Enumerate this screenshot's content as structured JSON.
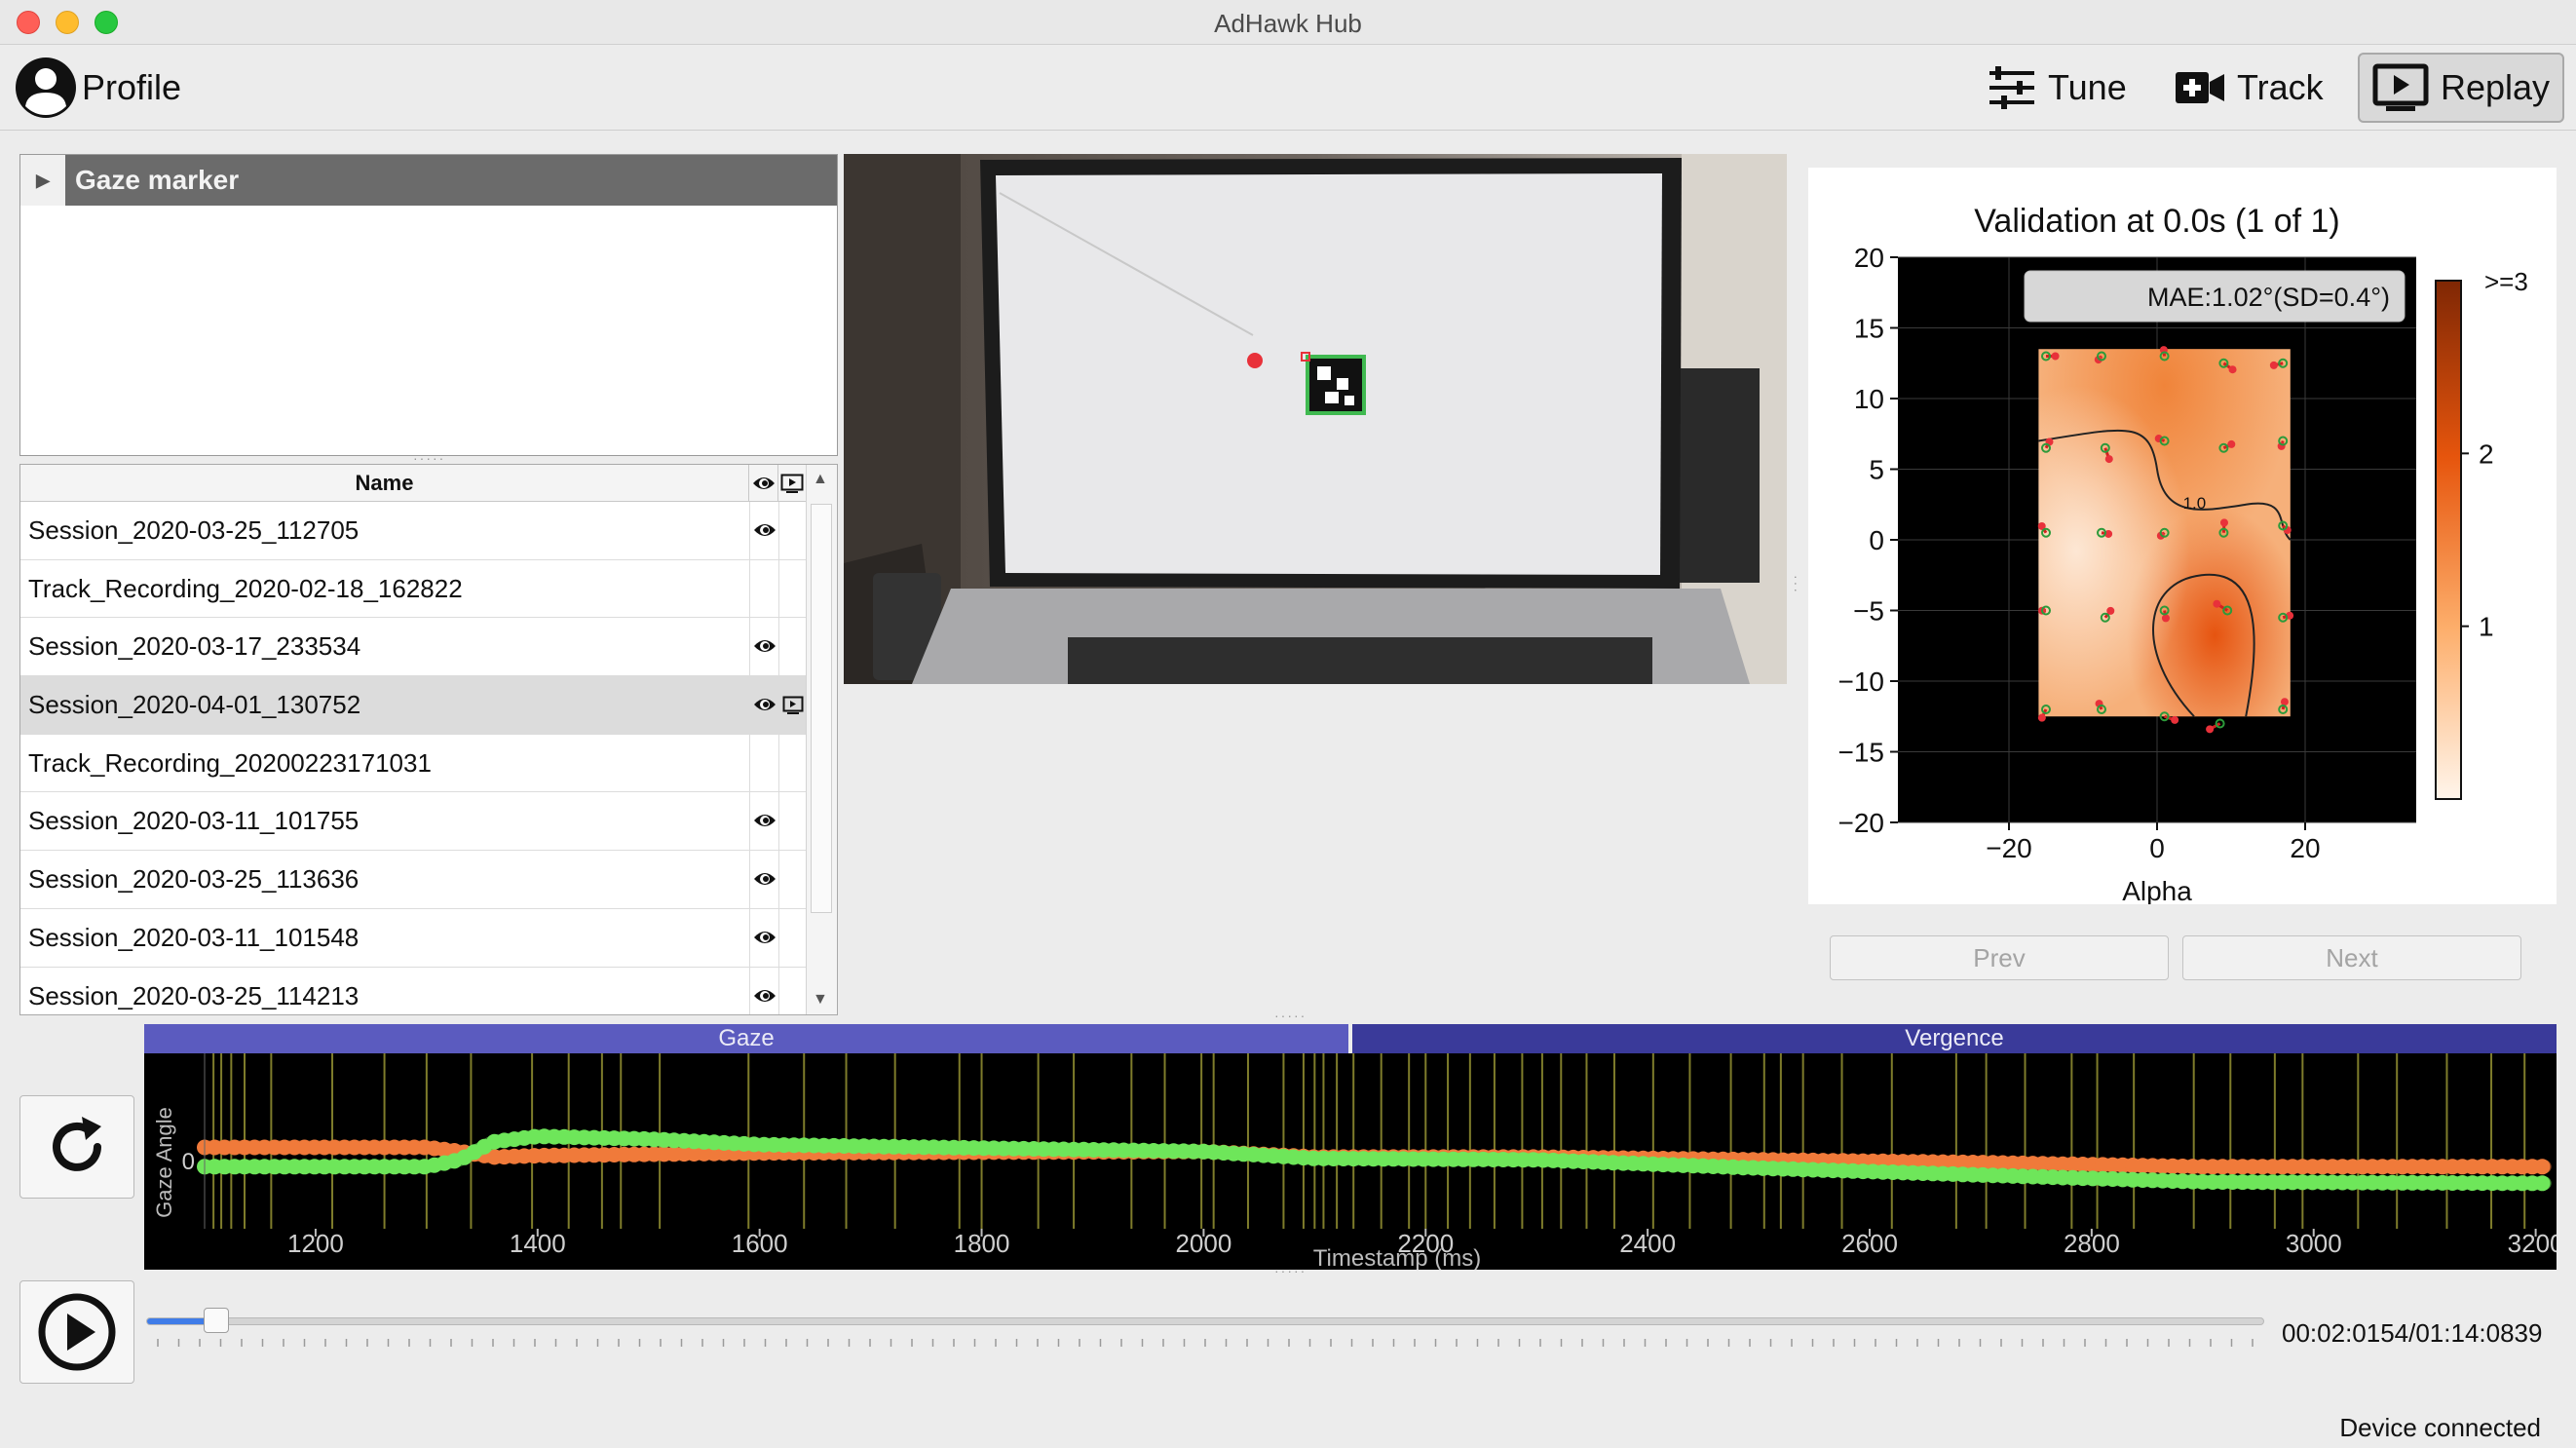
{
  "window": {
    "title": "AdHawk Hub"
  },
  "toolbar": {
    "profile_label": "Profile",
    "tune_label": "Tune",
    "track_label": "Track",
    "replay_label": "Replay",
    "active": "Replay"
  },
  "tree": {
    "items": [
      {
        "label": "Gaze marker",
        "expanded": false
      }
    ]
  },
  "sessions": {
    "header_name": "Name",
    "rows": [
      {
        "name": "Session_2020-03-25_112705",
        "eye": true,
        "replay": false,
        "selected": false
      },
      {
        "name": "Track_Recording_2020-02-18_162822",
        "eye": false,
        "replay": false,
        "selected": false
      },
      {
        "name": "Session_2020-03-17_233534",
        "eye": true,
        "replay": false,
        "selected": false
      },
      {
        "name": "Session_2020-04-01_130752",
        "eye": true,
        "replay": true,
        "selected": true
      },
      {
        "name": "Track_Recording_20200223171031",
        "eye": false,
        "replay": false,
        "selected": false
      },
      {
        "name": "Session_2020-03-11_101755",
        "eye": true,
        "replay": false,
        "selected": false
      },
      {
        "name": "Session_2020-03-25_113636",
        "eye": true,
        "replay": false,
        "selected": false
      },
      {
        "name": "Session_2020-03-11_101548",
        "eye": true,
        "replay": false,
        "selected": false
      },
      {
        "name": "Session_2020-03-25_114213",
        "eye": true,
        "replay": false,
        "selected": false
      }
    ]
  },
  "validation": {
    "title": "Validation at 0.0s (1 of 1)",
    "mae_label": "MAE:1.02°(SD=0.4°)",
    "xlabel": "Alpha",
    "colorbar_top_label": ">=3",
    "contour_label": "1.0",
    "prev_label": "Prev",
    "next_label": "Next"
  },
  "timeline": {
    "tab_gaze": "Gaze",
    "tab_vergence": "Vergence",
    "ylabel": "Gaze Angle",
    "xlabel": "Timestamp (ms)",
    "y_tick": "0",
    "position_text": "00:02:0154/01:14:0839",
    "progress": 0.033
  },
  "status": {
    "text": "Device connected"
  },
  "colors": {
    "gaze_tab": "#5b5bbf",
    "vergence_tab": "#3a3a9a",
    "series_orange": "#f07a3a",
    "series_green": "#6ee65a",
    "slider_fill": "#3f7ce8",
    "heat_dark": "#8c2d04",
    "heat_light": "#fff5eb"
  },
  "chart_data": [
    {
      "type": "heatmap",
      "title": "Validation at 0.0s (1 of 1)",
      "annotation": "MAE:1.02°(SD=0.4°)",
      "xlabel": "Alpha",
      "ylabel": "",
      "xlim": [
        -35,
        35
      ],
      "ylim": [
        -20,
        20
      ],
      "x_ticks": [
        "−20",
        "0",
        "20"
      ],
      "y_ticks": [
        "20",
        "15",
        "10",
        "5",
        "0",
        "−5",
        "−10",
        "−15",
        "−20"
      ],
      "colorbar": {
        "min": 0,
        "max": 3,
        "ticks": [
          "1",
          "2"
        ],
        "top_label": ">=3",
        "cmap": "oranges"
      },
      "grid": true,
      "heat_region": {
        "x": [
          -16,
          18
        ],
        "y": [
          -12.5,
          13.5
        ]
      },
      "targets": [
        {
          "x": -15,
          "y": 13,
          "e": 1.2
        },
        {
          "x": -7.5,
          "y": 13,
          "e": 0.6
        },
        {
          "x": 1,
          "y": 13,
          "e": 0.8
        },
        {
          "x": 9,
          "y": 12.5,
          "e": 1.4
        },
        {
          "x": 17,
          "y": 12.5,
          "e": 1.2
        },
        {
          "x": -15,
          "y": 6.5,
          "e": 0.9
        },
        {
          "x": -7,
          "y": 6.5,
          "e": 1.5
        },
        {
          "x": 1,
          "y": 7,
          "e": 0.8
        },
        {
          "x": 9,
          "y": 6.5,
          "e": 1.1
        },
        {
          "x": 17,
          "y": 7,
          "e": 0.7
        },
        {
          "x": -15,
          "y": 0.5,
          "e": 1.0
        },
        {
          "x": -7.5,
          "y": 0.5,
          "e": 0.9
        },
        {
          "x": 1,
          "y": 0.5,
          "e": 0.6
        },
        {
          "x": 9,
          "y": 0.5,
          "e": 1.3
        },
        {
          "x": 17,
          "y": 1,
          "e": 0.8
        },
        {
          "x": -15,
          "y": -5,
          "e": 0.5
        },
        {
          "x": -7,
          "y": -5.5,
          "e": 1.1
        },
        {
          "x": 1,
          "y": -5,
          "e": 1.0
        },
        {
          "x": 9.5,
          "y": -5,
          "e": 1.6
        },
        {
          "x": 17,
          "y": -5.5,
          "e": 0.9
        },
        {
          "x": -15,
          "y": -12,
          "e": 1.2
        },
        {
          "x": -7.5,
          "y": -12,
          "e": 0.8
        },
        {
          "x": 1,
          "y": -12.5,
          "e": 1.4
        },
        {
          "x": 8.5,
          "y": -13,
          "e": 1.5
        },
        {
          "x": 17,
          "y": -12,
          "e": 1.0
        }
      ]
    },
    {
      "type": "scatter",
      "xlabel": "Timestamp (ms)",
      "ylabel": "Gaze Angle",
      "xlim": [
        1100,
        3210
      ],
      "ylim": [
        -12,
        12
      ],
      "x_ticks": [
        1200,
        1400,
        1600,
        1800,
        2000,
        2200,
        2400,
        2600,
        2800,
        3000,
        3200
      ],
      "y_ticks": [
        0
      ],
      "series": [
        {
          "color": "orange",
          "x": [
            1100,
            1300,
            1330,
            1360,
            1400,
            1500,
            1600,
            2000,
            2100,
            2300,
            2500,
            2700,
            2900,
            3200
          ],
          "y": [
            1.2,
            1.2,
            0.6,
            -0.2,
            0.0,
            0.2,
            0.4,
            0.6,
            -0.2,
            -0.2,
            -0.6,
            -1.0,
            -1.6,
            -1.6
          ]
        },
        {
          "color": "green",
          "x": [
            1100,
            1300,
            1330,
            1360,
            1400,
            1500,
            1600,
            2000,
            2100,
            2300,
            2500,
            2700,
            2900,
            3200
          ],
          "y": [
            -1.6,
            -1.6,
            -0.6,
            2.0,
            2.8,
            2.4,
            1.6,
            0.6,
            -0.4,
            -0.6,
            -1.8,
            -2.8,
            -3.8,
            -4.0
          ]
        }
      ],
      "event_markers_x": [
        1108,
        1115,
        1124,
        1136,
        1160,
        1215,
        1262,
        1300,
        1340,
        1395,
        1428,
        1458,
        1475,
        1510,
        1590,
        1640,
        1678,
        1722,
        1780,
        1800,
        1851,
        1883,
        1935,
        1965,
        1998,
        2009,
        2040,
        2072,
        2090,
        2100,
        2108,
        2120,
        2135,
        2160,
        2185,
        2200,
        2220,
        2240,
        2262,
        2287,
        2305,
        2322,
        2345,
        2370,
        2405,
        2438,
        2475,
        2505,
        2520,
        2540,
        2575,
        2620,
        2678,
        2705,
        2740,
        2782,
        2805,
        2838,
        2892,
        2925,
        2965,
        2990,
        3040,
        3075,
        3120,
        3160,
        3190
      ]
    }
  ]
}
